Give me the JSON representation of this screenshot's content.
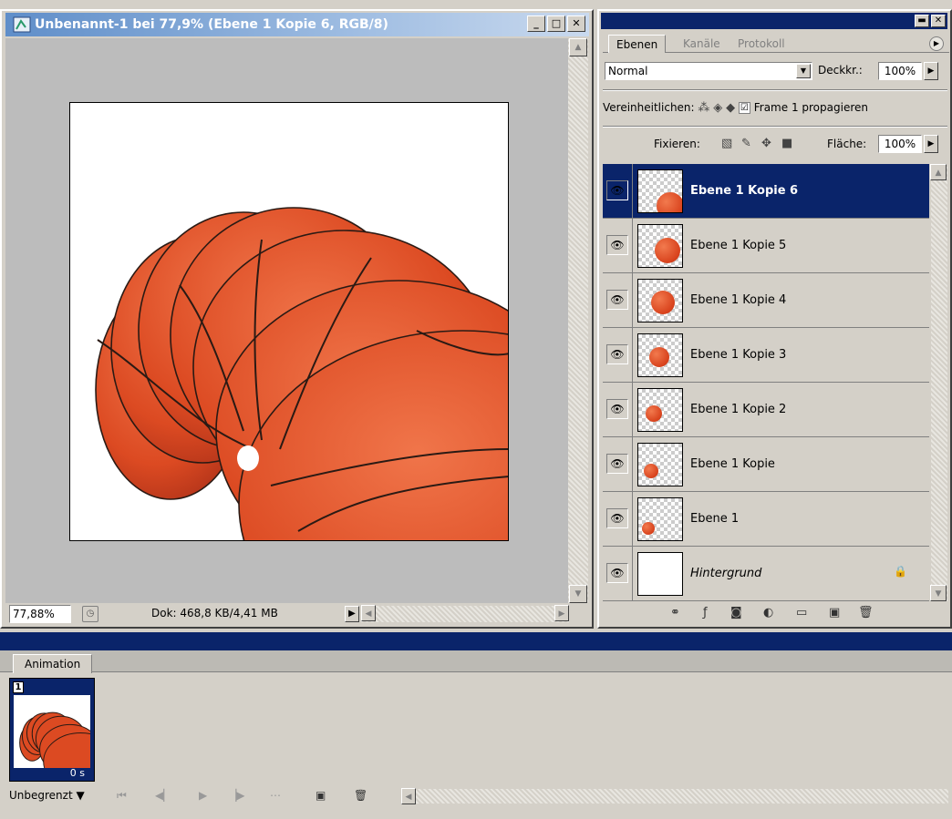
{
  "document": {
    "title": "Unbenannt-1 bei 77,9% (Ebene 1 Kopie 6, RGB/8)",
    "zoom": "77,88%",
    "doc_info": "Dok: 468,8 KB/4,41 MB"
  },
  "layers_panel": {
    "tabs": [
      "Ebenen",
      "Kanäle",
      "Protokoll"
    ],
    "blend_mode": "Normal",
    "opacity_label": "Deckkr.:",
    "opacity_value": "100%",
    "unify_label": "Vereinheitlichen:",
    "propagate_label": "Frame 1 propagieren",
    "propagate_checked": "☑",
    "lock_label": "Fixieren:",
    "fill_label": "Fläche:",
    "fill_value": "100%",
    "layers": [
      {
        "name": "Ebene 1 Kopie 6",
        "selected": true
      },
      {
        "name": "Ebene 1 Kopie 5",
        "selected": false
      },
      {
        "name": "Ebene 1 Kopie 4",
        "selected": false
      },
      {
        "name": "Ebene 1 Kopie 3",
        "selected": false
      },
      {
        "name": "Ebene 1 Kopie 2",
        "selected": false
      },
      {
        "name": "Ebene 1 Kopie",
        "selected": false
      },
      {
        "name": "Ebene 1",
        "selected": false
      },
      {
        "name": "Hintergrund",
        "selected": false,
        "locked": true
      }
    ]
  },
  "animation": {
    "tab": "Animation",
    "frame_number": "1",
    "frame_time": "0 s",
    "loop": "Unbegrenzt"
  },
  "colors": {
    "selection": "#0a246a",
    "ball": "#d8421c"
  }
}
